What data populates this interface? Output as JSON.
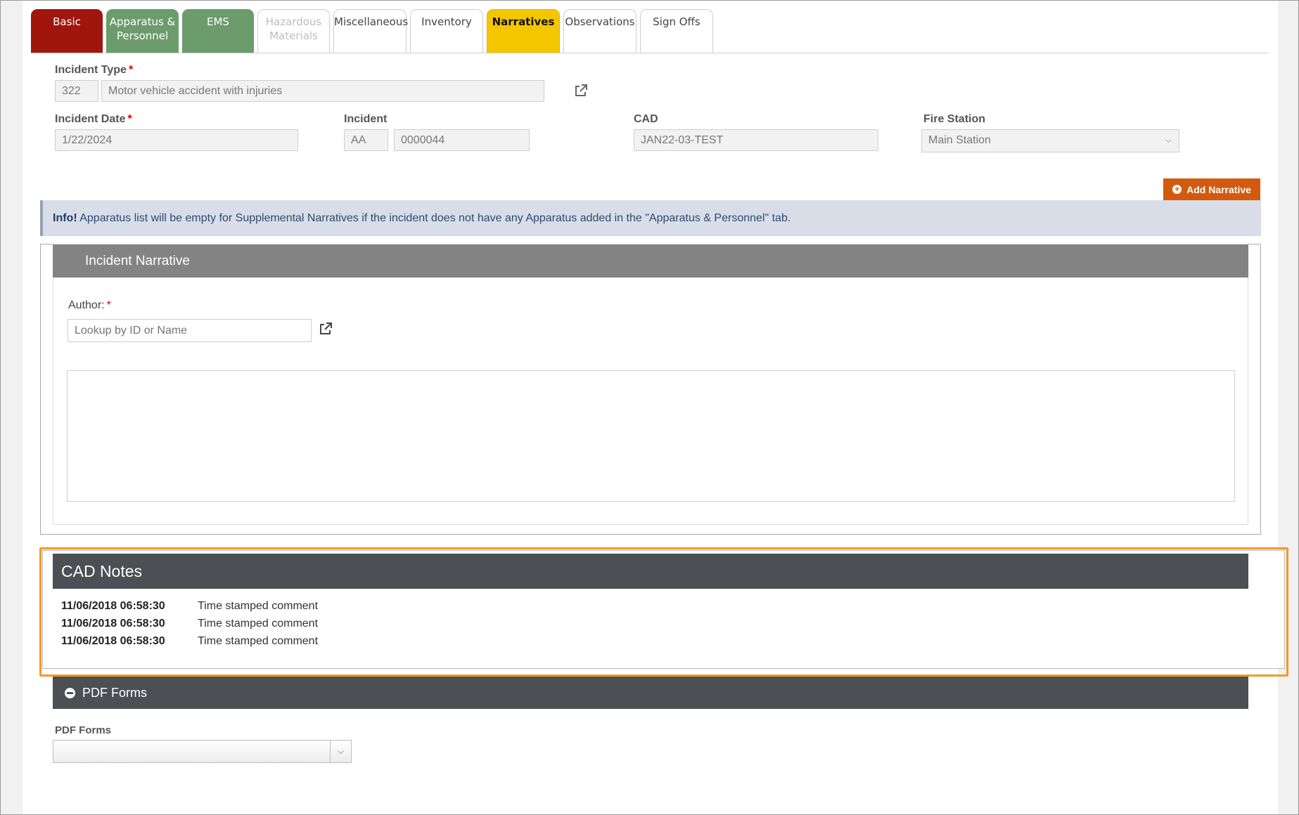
{
  "tabs": [
    {
      "line1": "Basic",
      "line2": "",
      "style": "red"
    },
    {
      "line1": "Apparatus &",
      "line2": "Personnel",
      "style": "green"
    },
    {
      "line1": "EMS",
      "line2": "",
      "style": "green"
    },
    {
      "line1": "Hazardous",
      "line2": "Materials",
      "style": "disabled"
    },
    {
      "line1": "Miscellaneous",
      "line2": "",
      "style": "normal"
    },
    {
      "line1": "Inventory",
      "line2": "",
      "style": "normal"
    },
    {
      "line1": "Narratives",
      "line2": "",
      "style": "yellow"
    },
    {
      "line1": "Observations",
      "line2": "",
      "style": "normal"
    },
    {
      "line1": "Sign Offs",
      "line2": "",
      "style": "normal"
    }
  ],
  "form": {
    "incident_type_label": "Incident Type",
    "incident_type_code": "322",
    "incident_type_desc": "Motor vehicle accident with injuries",
    "incident_date_label": "Incident Date",
    "incident_date_value": "1/22/2024",
    "incident_label": "Incident",
    "incident_prefix": "AA",
    "incident_number": "0000044",
    "cad_label": "CAD",
    "cad_value": "JAN22-03-TEST",
    "fire_station_label": "Fire Station",
    "fire_station_value": "Main Station",
    "required_mark": "*"
  },
  "actions": {
    "add_narrative": "Add Narrative"
  },
  "info": {
    "prefix": "Info!",
    "message": " Apparatus list will be empty for Supplemental Narratives if the incident does not have any Apparatus added in the \"Apparatus & Personnel\" tab."
  },
  "narrative": {
    "title": "Incident Narrative",
    "author_label": "Author:",
    "author_placeholder": "Lookup by ID or Name"
  },
  "cad_notes": {
    "title": "CAD Notes",
    "rows": [
      {
        "timestamp": "11/06/2018 06:58:30",
        "comment": "Time stamped comment"
      },
      {
        "timestamp": "11/06/2018 06:58:30",
        "comment": "Time stamped comment"
      },
      {
        "timestamp": "11/06/2018 06:58:30",
        "comment": "Time stamped comment"
      }
    ]
  },
  "pdf": {
    "header": "PDF Forms",
    "label": "PDF Forms"
  },
  "colors": {
    "tab_red": "#a0160d",
    "tab_green": "#6c9b6c",
    "tab_yellow": "#f4c600",
    "accent_orange": "#d25a0e",
    "highlight_orange": "#f39a1f"
  }
}
